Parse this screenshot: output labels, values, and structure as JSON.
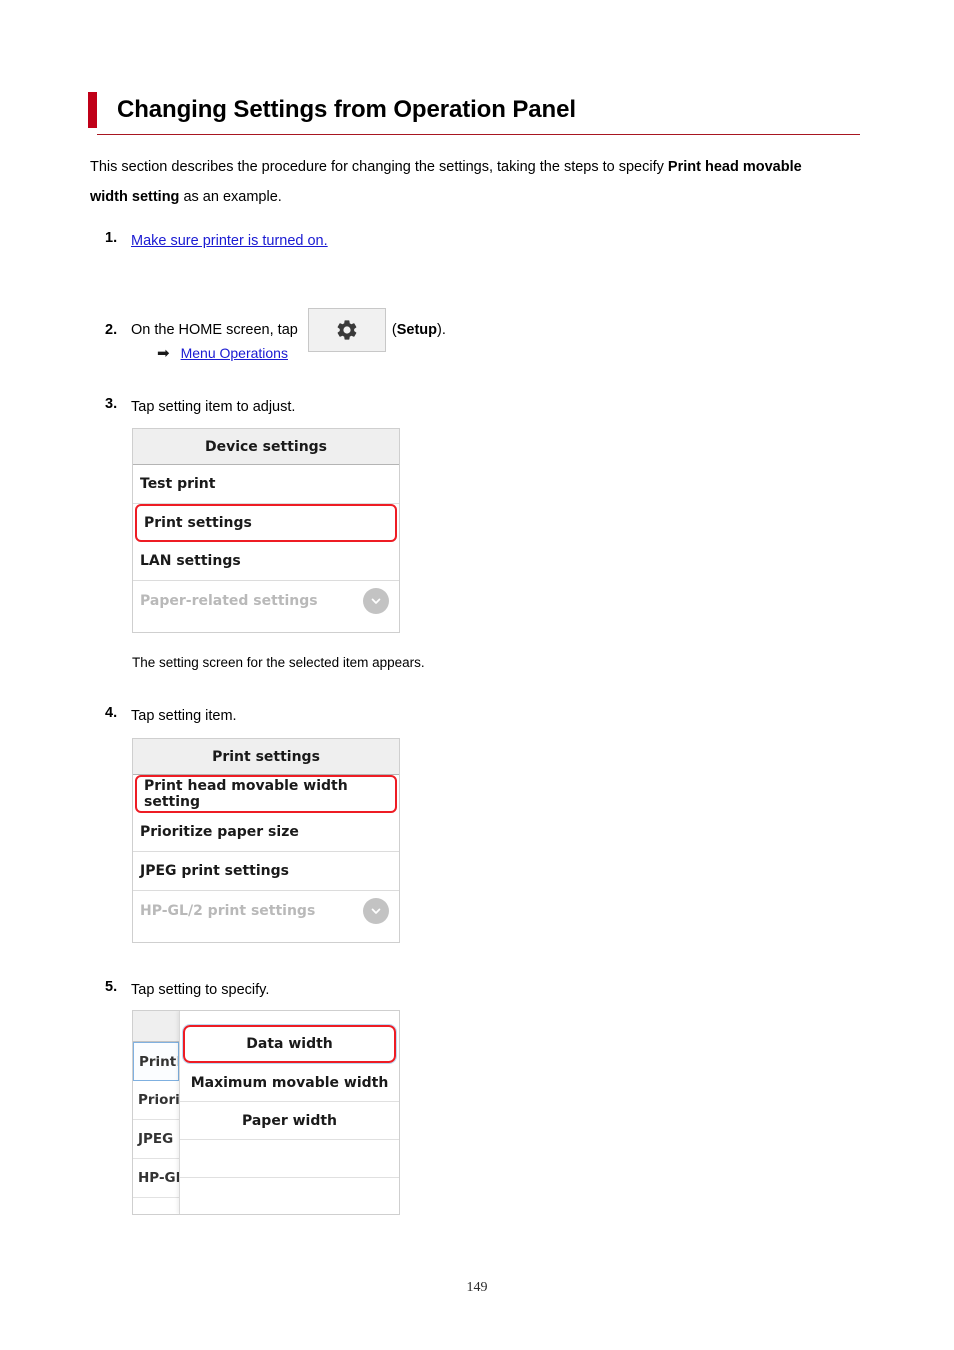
{
  "document": {
    "title": "Changing Settings from Operation Panel",
    "accent_color": "#c00018",
    "rule_color": "#a81621",
    "page_number": "149"
  },
  "intro": {
    "part1": "This section describes the procedure for changing the settings, taking the steps to specify ",
    "bold1": "Print head movable width setting",
    "part2": " as an example."
  },
  "steps": {
    "step1": {
      "number": "1.",
      "link_text": "Make sure printer is turned on."
    },
    "step2": {
      "number": "2.",
      "text_before": "On the HOME screen, tap",
      "icon_name": "gear-icon",
      "text_after_open": "(",
      "bold_label": "Setup",
      "text_after_close": ").",
      "sublink": {
        "arrow": "➡",
        "label": "Menu Operations"
      }
    },
    "step3": {
      "number": "3.",
      "text": "Tap setting item to adjust.",
      "note": "The setting screen for the selected item appears."
    },
    "step4": {
      "number": "4.",
      "text": "Tap setting item."
    },
    "step5": {
      "number": "5.",
      "text": "Tap setting to specify."
    }
  },
  "panel_device_settings": {
    "header": "Device settings",
    "items": [
      {
        "label": "Test print",
        "state": "normal"
      },
      {
        "label": "Print settings",
        "state": "highlighted"
      },
      {
        "label": "LAN settings",
        "state": "normal"
      },
      {
        "label": "Paper-related settings",
        "state": "faded",
        "icon": "chevron-down-icon"
      }
    ]
  },
  "panel_print_settings": {
    "header": "Print settings",
    "items": [
      {
        "label": "Print head movable width setting",
        "state": "highlighted"
      },
      {
        "label": "Prioritize paper size",
        "state": "normal"
      },
      {
        "label": "JPEG print settings",
        "state": "normal"
      },
      {
        "label": "HP-GL/2 print settings",
        "state": "faded",
        "icon": "chevron-down-icon"
      }
    ]
  },
  "panel_width_dialog": {
    "background_items": [
      {
        "label": "Print",
        "tail": " h",
        "state": "selected"
      },
      {
        "label": "Priorit",
        "tail": "",
        "state": "normal"
      },
      {
        "label": "JPEG",
        "tail": " ",
        "state": "normal"
      },
      {
        "label": "HP-GL",
        "tail": "",
        "state": "normal"
      }
    ],
    "overlay_items": [
      {
        "label": "Data width",
        "state": "highlighted"
      },
      {
        "label": "Maximum movable width",
        "state": "normal"
      },
      {
        "label": "Paper width",
        "state": "normal"
      },
      {
        "label": "",
        "state": "empty"
      },
      {
        "label": "",
        "state": "empty"
      }
    ]
  }
}
